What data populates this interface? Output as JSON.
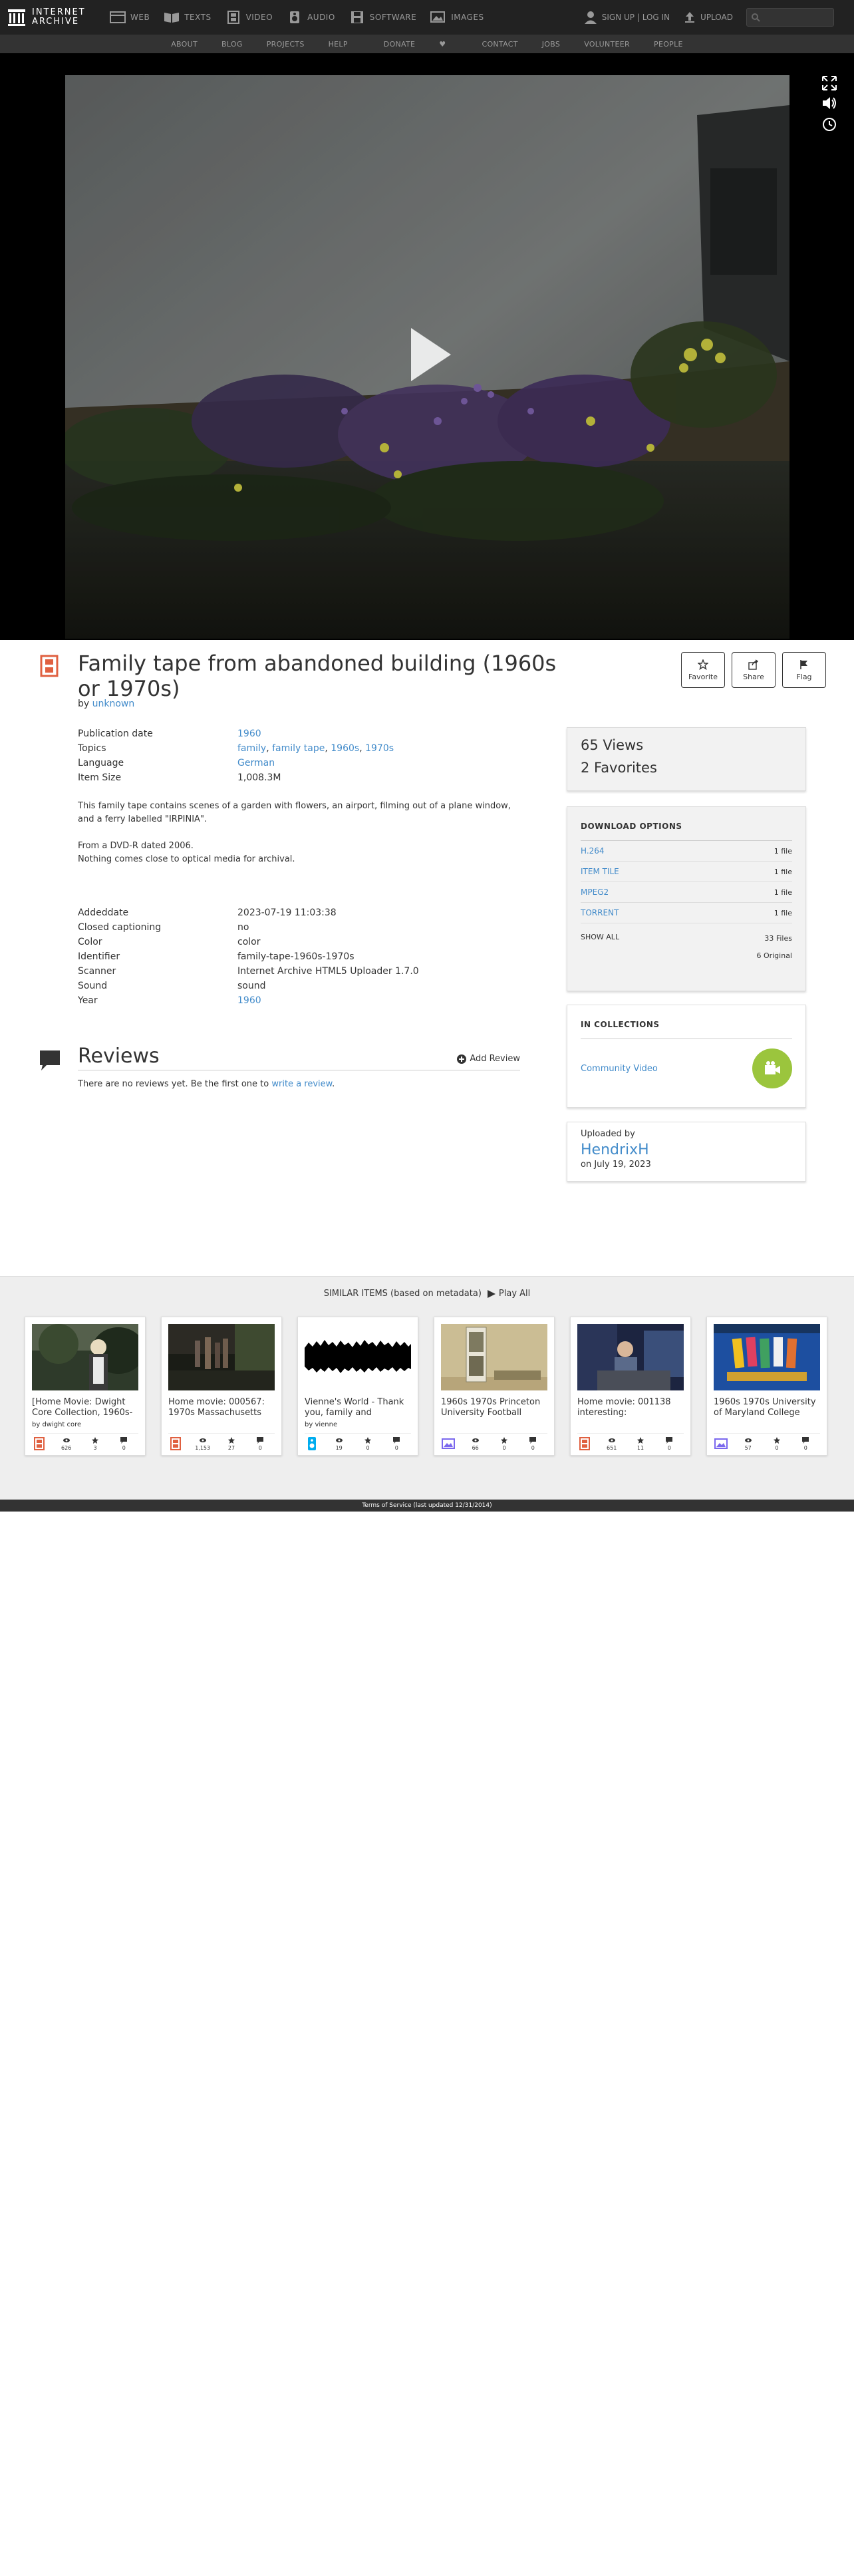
{
  "nav": {
    "logo_line1": "INTERNET",
    "logo_line2": "ARCHIVE",
    "media": [
      {
        "label": "WEB",
        "icon": "web-icon"
      },
      {
        "label": "TEXTS",
        "icon": "book-icon"
      },
      {
        "label": "VIDEO",
        "icon": "film-icon"
      },
      {
        "label": "AUDIO",
        "icon": "speaker-icon"
      },
      {
        "label": "SOFTWARE",
        "icon": "floppy-icon"
      },
      {
        "label": "IMAGES",
        "icon": "image-icon"
      }
    ],
    "signin": "SIGN UP | LOG IN",
    "upload": "UPLOAD",
    "sub": [
      "ABOUT",
      "BLOG",
      "PROJECTS",
      "HELP",
      "DONATE",
      "CONTACT",
      "JOBS",
      "VOLUNTEER",
      "PEOPLE"
    ]
  },
  "item": {
    "title": "Family tape from abandoned building (1960s or 1970s)",
    "by_label": "by",
    "creator": "unknown",
    "actions": {
      "favorite": "Favorite",
      "share": "Share",
      "flag": "Flag"
    }
  },
  "meta": {
    "publication_date_label": "Publication date",
    "publication_date": "1960",
    "topics_label": "Topics",
    "topics": [
      "family",
      "family tape",
      "1960s",
      "1970s"
    ],
    "language_label": "Language",
    "language": "German",
    "item_size_label": "Item Size",
    "item_size": "1,008.3M"
  },
  "description": {
    "p1": "This family tape contains scenes of a garden with flowers, an airport, filming out of a plane window, and a ferry labelled \"IRPINIA\".",
    "p2a": "From a DVD-R dated 2006.",
    "p2b": "Nothing comes close to optical media for archival."
  },
  "meta2": [
    {
      "label": "Addeddate",
      "value": "2023-07-19 11:03:38",
      "link": false
    },
    {
      "label": "Closed captioning",
      "value": "no",
      "link": false
    },
    {
      "label": "Color",
      "value": "color",
      "link": false
    },
    {
      "label": "Identifier",
      "value": "family-tape-1960s-1970s",
      "link": false
    },
    {
      "label": "Scanner",
      "value": "Internet Archive HTML5 Uploader 1.7.0",
      "link": false
    },
    {
      "label": "Sound",
      "value": "sound",
      "link": false
    },
    {
      "label": "Year",
      "value": "1960",
      "link": true
    }
  ],
  "reviews": {
    "title": "Reviews",
    "add": "Add Review",
    "none_text": "There are no reviews yet. Be the first one to",
    "write_link": "write a review",
    "period": "."
  },
  "stats": {
    "views": "65 Views",
    "favorites": "2 Favorites"
  },
  "downloads": {
    "heading": "DOWNLOAD OPTIONS",
    "rows": [
      {
        "format": "H.264",
        "count": "1 file"
      },
      {
        "format": "ITEM TILE",
        "count": "1 file"
      },
      {
        "format": "MPEG2",
        "count": "1 file"
      },
      {
        "format": "TORRENT",
        "count": "1 file"
      }
    ],
    "show_all": "SHOW ALL",
    "total_files": "33 Files",
    "original": "6 Original"
  },
  "collections": {
    "heading": "IN COLLECTIONS",
    "name": "Community Video"
  },
  "uploader": {
    "label": "Uploaded by",
    "name": "HendrixH",
    "date": "on July 19, 2023"
  },
  "similar": {
    "heading": "SIMILAR ITEMS (based on metadata)",
    "play_all": "Play All",
    "cards": [
      {
        "title": "[Home Movie: Dwight Core Collection, 1960s-",
        "by": "by dwight core",
        "type": "film-icon",
        "views": "626",
        "favs": "3",
        "reviews": "0"
      },
      {
        "title": "Home movie: 000567: 1970s Massachusetts",
        "by": "",
        "type": "film-icon",
        "views": "1,153",
        "favs": "27",
        "reviews": "0"
      },
      {
        "title": "Vienne's World - Thank you, family and",
        "by": "by vienne",
        "type": "audio-icon",
        "views": "19",
        "favs": "0",
        "reviews": "0"
      },
      {
        "title": "1960s 1970s Princeton University Football",
        "by": "",
        "type": "image-icon",
        "views": "66",
        "favs": "0",
        "reviews": "0"
      },
      {
        "title": "Home movie: 001138 interesting:",
        "by": "",
        "type": "film-icon",
        "views": "651",
        "favs": "11",
        "reviews": "0"
      },
      {
        "title": "1960s 1970s University of Maryland College",
        "by": "",
        "type": "image-icon",
        "views": "57",
        "favs": "0",
        "reviews": "0"
      }
    ]
  },
  "footer": "Terms of Service (last updated 12/31/2014)",
  "colors": {
    "accent": "#428bca",
    "film": "#e06040",
    "audio": "#00adef",
    "collection": "#9bc53d",
    "nav_bg": "#222222"
  }
}
